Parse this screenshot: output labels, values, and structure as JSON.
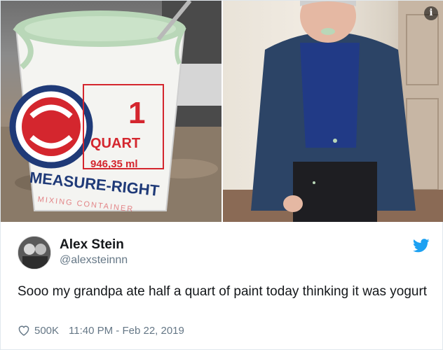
{
  "media": {
    "photos": [
      {
        "subject": "paint-bucket"
      },
      {
        "subject": "person"
      }
    ],
    "bucket": {
      "line1": "1",
      "line2": "QUART",
      "line3": "946,35 ml",
      "brand": "MEASURE-RIGHT",
      "tagline": "MIXING CONTAINER"
    },
    "info_icon": "info-icon"
  },
  "tweet": {
    "display_name": "Alex Stein",
    "handle": "@alexsteinnn",
    "text": "Sooo my grandpa ate half a quart of paint today thinking it was yogurt",
    "likes": "500K",
    "timestamp": "11:40 PM - Feb 22, 2019"
  },
  "icons": {
    "bird": "twitter-bird-icon",
    "heart": "heart-icon"
  },
  "colors": {
    "bird_blue": "#1da1f2",
    "secondary_text": "#657786",
    "bucket_red": "#d4262e",
    "bucket_navy": "#1f3a78",
    "paint_green": "#b9d7b8"
  }
}
